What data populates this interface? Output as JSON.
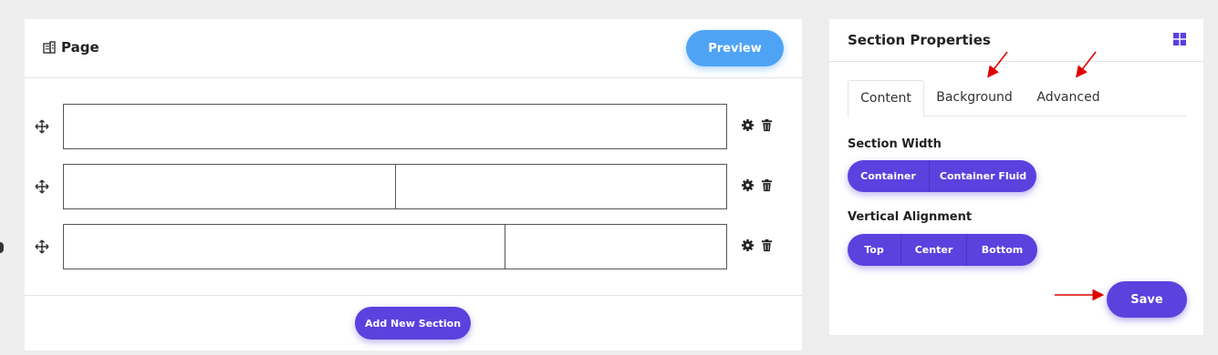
{
  "page": {
    "title": "Page",
    "preview_label": "Preview",
    "add_section_label": "Add New Section",
    "sections": [
      {
        "columns": [
          1
        ]
      },
      {
        "columns": [
          1,
          1
        ]
      },
      {
        "columns": [
          2,
          1
        ]
      }
    ]
  },
  "properties": {
    "title": "Section Properties",
    "tabs": [
      {
        "label": "Content",
        "active": true
      },
      {
        "label": "Background",
        "active": false
      },
      {
        "label": "Advanced",
        "active": false
      }
    ],
    "section_width": {
      "label": "Section Width",
      "options": [
        "Container",
        "Container Fluid"
      ]
    },
    "vertical_alignment": {
      "label": "Vertical Alignment",
      "options": [
        "Top",
        "Center",
        "Bottom"
      ]
    },
    "save_label": "Save"
  },
  "colors": {
    "primary": "#5b41de",
    "preview": "#4ea3f5",
    "annotation": "#e00000"
  },
  "icons": [
    "building-icon",
    "move-icon",
    "gear-icon",
    "trash-icon",
    "grid-icon"
  ]
}
